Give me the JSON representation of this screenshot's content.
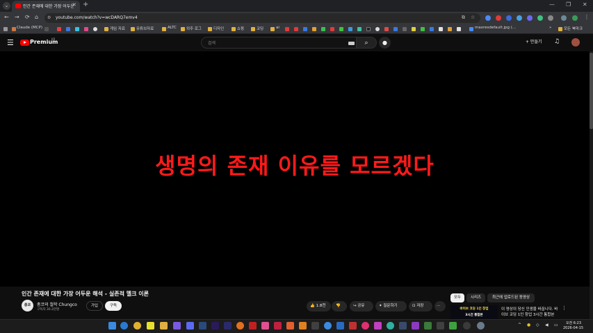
{
  "browser": {
    "tab_title": "인간 존재에 대한 가장 어두운",
    "new_tab": "+",
    "url": "youtube.com/watch?v=wcDARQ7emv4",
    "minimize": "—",
    "restore": "❐",
    "close": "✕",
    "nav_back": "←",
    "nav_forward": "→",
    "reload": "⟳",
    "home": "⌂",
    "bookmarks": [
      {
        "label": "Claude (MCP)",
        "color": "#cc7744"
      },
      {
        "label": "게임 자료",
        "color": "#8a8a8a"
      },
      {
        "label": "유튜브자료",
        "color": "#8a8a8a"
      },
      {
        "label": "ALTC",
        "color": "#8a8a8a"
      },
      {
        "label": "외주 로그",
        "color": "#8a8a8a"
      },
      {
        "label": "디자인",
        "color": "#8a8a8a"
      },
      {
        "label": "쇼핑",
        "color": "#8a8a8a"
      },
      {
        "label": "코딩",
        "color": "#8a8a8a"
      },
      {
        "label": "ai",
        "color": "#8a8a8a"
      },
      {
        "label": "maxresdefault.jpg (...",
        "color": "#4a8af4"
      },
      {
        "label": "모든 북마크",
        "color": "#8a8a8a"
      }
    ]
  },
  "youtube": {
    "brand": "Premium",
    "region_badge": "KR",
    "search_placeholder": "검색",
    "search_icon": "⌕",
    "mic_icon": "🎙",
    "create_label": "+ 만들기",
    "bell_icon": "🔔",
    "menu_icon": "☰"
  },
  "video": {
    "overlay_text": "생명의 존재 이유를 모르겠다",
    "title": "인간 존재에 대한 가장 어두운 해석 - 실존적 멜크 이론",
    "channel_avatar_text": "총코",
    "channel_name": "총코의 철학 Chungco",
    "subscribers": "구독자 30.2만명",
    "join_label": "가입",
    "subscribe_label": "구독",
    "like_label": "👍 1.8천",
    "dislike_label": "👎",
    "share_label": "↪ 공유",
    "ask_label": "✦ 질문하기",
    "save_label": "⊡ 저장",
    "more_label": "···"
  },
  "sidebar": {
    "chips": [
      "모두",
      "시리즈",
      "최근에 업로드된 동영상"
    ],
    "rec_thumb_line1": "바이브 코딩 1인 창업",
    "rec_thumb_line2": "3시간 통합본",
    "rec_title_line1": "이 영상이 당신 인생을 바꿉니다. 바",
    "rec_title_line2": "이브 코딩 1인 창업 3시간 통합본",
    "rec_more": "⋮"
  },
  "taskbar": {
    "time": "오전 6:23",
    "date": "2026-04-15",
    "tray_up": "^"
  }
}
